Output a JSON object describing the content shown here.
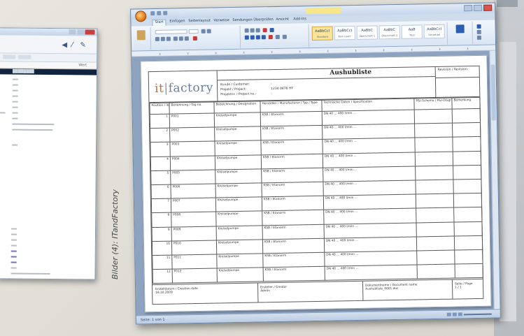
{
  "caption": "Bilder (4): ITandFactory",
  "left_window": {
    "column_header": "Wert"
  },
  "word": {
    "tabs": [
      "Start",
      "Einfügen",
      "Seitenlayout",
      "Verweise",
      "Sendungen",
      "Überprüfen",
      "Ansicht",
      "Add-Ins"
    ],
    "styles": [
      {
        "preview": "AaBbCcI",
        "name": "Standard"
      },
      {
        "preview": "AaBbCcI",
        "name": "Kein Leerr."
      },
      {
        "preview": "AaBbC",
        "name": "Überschrift 1"
      },
      {
        "preview": "AaBbC",
        "name": "Überschrift 2"
      },
      {
        "preview": "AaB",
        "name": "Titel"
      },
      {
        "preview": "AaBbCcI",
        "name": "Untertitel"
      }
    ],
    "status": "Seite: 1 von 1"
  },
  "form": {
    "logo": {
      "left": "it",
      "sep": "|",
      "right": "factory"
    },
    "title": "Aushubliste",
    "fields": [
      {
        "label": "Kunde / Customer:",
        "value": ":"
      },
      {
        "label": "Projekt / Project:",
        "value": "1234 0876 HY"
      },
      {
        "label": "Projektnr. / Project no.:",
        "value": ":"
      }
    ],
    "revision_label": "Revision / Revision:",
    "columns": [
      "Position / item no.",
      "Benennung / Tag no.",
      "Bezeichnung / Designation",
      "Hersteller / Manufacturer / Typ / Type",
      "Technische Daten / Specification",
      "P&I-Schema / P&I-Diagram",
      "Bemerkung"
    ],
    "rows": [
      {
        "pos": "1",
        "tag": "P001",
        "desc": "Kreiselpumpe",
        "type": "KSB / Etanorm",
        "spec": "DN 40 ... 400 l/min ..."
      },
      {
        "pos": "2",
        "tag": "P002",
        "desc": "Kreiselpumpe",
        "type": "KSB / Etanorm",
        "spec": "DN 40 ... 400 l/min ..."
      },
      {
        "pos": "3",
        "tag": "P003",
        "desc": "Kreiselpumpe",
        "type": "KSB / Etanorm",
        "spec": "DN 40 ... 400 l/min ..."
      },
      {
        "pos": "4",
        "tag": "P004",
        "desc": "Kreiselpumpe",
        "type": "KSB / Etanorm",
        "spec": "DN 40 ... 400 l/min ..."
      },
      {
        "pos": "5",
        "tag": "P005",
        "desc": "Kreiselpumpe",
        "type": "KSB / Etanorm",
        "spec": "DN 40 ... 400 l/min ..."
      },
      {
        "pos": "6",
        "tag": "P006",
        "desc": "Kreiselpumpe",
        "type": "KSB / Etanorm",
        "spec": "DN 40 ... 400 l/min ..."
      },
      {
        "pos": "7",
        "tag": "P007",
        "desc": "Kreiselpumpe",
        "type": "KSB / Etanorm",
        "spec": "DN 40 ... 400 l/min ..."
      },
      {
        "pos": "8",
        "tag": "P008",
        "desc": "Kreiselpumpe",
        "type": "KSB / Etanorm",
        "spec": "DN 40 ... 400 l/min ..."
      },
      {
        "pos": "9",
        "tag": "P009",
        "desc": "Kreiselpumpe",
        "type": "KSB / Etanorm",
        "spec": "DN 40 ... 400 l/min ..."
      },
      {
        "pos": "10",
        "tag": "P010",
        "desc": "Kreiselpumpe",
        "type": "KSB / Etanorm",
        "spec": "DN 40 ... 400 l/min ..."
      },
      {
        "pos": "11",
        "tag": "P011",
        "desc": "Kreiselpumpe",
        "type": "KSB / Etanorm",
        "spec": "DN 40 ... 400 l/min ..."
      },
      {
        "pos": "12",
        "tag": "P012",
        "desc": "Kreiselpumpe",
        "type": "KSB / Etanorm",
        "spec": "DN 40 ... 400 l/min ..."
      }
    ],
    "footer": {
      "created_label": "Erstelldatum / Creation date",
      "created_value": "16.10.2009",
      "creator_label": "Ersteller / Creator",
      "creator_value": "Admin",
      "docname_label": "Dokumentname / Document name",
      "docname_value": "Aushubliste_0001.doc",
      "page_label": "Seite / Page",
      "page_value": "1 / 1"
    }
  }
}
